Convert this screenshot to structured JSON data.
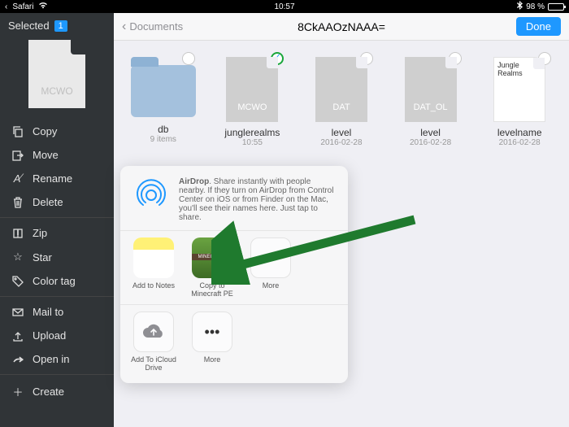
{
  "statusbar": {
    "app": "Safari",
    "time": "10:57",
    "battery_pct": "98 %"
  },
  "sidebar": {
    "selected_label": "Selected",
    "selected_count": "1",
    "thumb_label": "MCWO",
    "items": [
      {
        "label": "Copy"
      },
      {
        "label": "Move"
      },
      {
        "label": "Rename"
      },
      {
        "label": "Delete"
      },
      {
        "label": "Zip"
      },
      {
        "label": "Star"
      },
      {
        "label": "Color tag"
      },
      {
        "label": "Mail to"
      },
      {
        "label": "Upload"
      },
      {
        "label": "Open in"
      },
      {
        "label": "Create"
      }
    ]
  },
  "nav": {
    "back": "Documents",
    "title": "8CkAAOzNAAA=",
    "done": "Done"
  },
  "files": [
    {
      "name": "db",
      "meta": "9 items",
      "kind": "folder"
    },
    {
      "name": "junglerealms",
      "meta": "10:55",
      "kind": "doc",
      "doclabel": "MCWO",
      "selected": true
    },
    {
      "name": "level",
      "meta": "2016-02-28",
      "kind": "doc",
      "doclabel": "DAT"
    },
    {
      "name": "level",
      "meta": "2016-02-28",
      "kind": "doc",
      "doclabel": "DAT_OL"
    },
    {
      "name": "levelname",
      "meta": "2016-02-28",
      "kind": "whitedoc",
      "doclabel": "Jungle Realms"
    }
  ],
  "popover": {
    "airdrop_title": "AirDrop",
    "airdrop_text": ". Share instantly with people nearby. If they turn on AirDrop from Control Center on iOS or from Finder on the Mac, you'll see their names here. Just tap to share.",
    "row1": [
      {
        "label": "Add to Notes",
        "tile": "notes"
      },
      {
        "label": "Copy to Minecraft PE",
        "tile": "mc"
      },
      {
        "label": "More",
        "tile": "more"
      }
    ],
    "row2": [
      {
        "label": "Add To iCloud Drive",
        "tile": "cloud"
      },
      {
        "label": "More",
        "tile": "more"
      }
    ]
  }
}
